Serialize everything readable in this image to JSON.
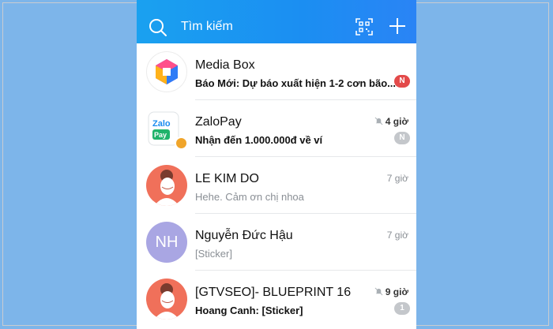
{
  "header": {
    "search_placeholder": "Tìm kiếm"
  },
  "colors": {
    "header_gradient_start": "#1aa1f0",
    "header_gradient_end": "#2a84f5",
    "badge_unread": "#e34a4a",
    "badge_muted": "#c4c7cb",
    "backdrop": "#7db5ea"
  },
  "icons": {
    "search": "search-icon",
    "qr": "qr-scan-icon",
    "add": "plus-icon",
    "muted": "muted-bell-icon"
  },
  "conversations": [
    {
      "name": "Media Box",
      "preview": "Báo Mới: Dự báo xuất hiện 1-2 cơn bão...",
      "time": "",
      "badge": "N",
      "muted": false,
      "unread": true
    },
    {
      "name": "ZaloPay",
      "preview": "Nhận đến 1.000.000đ về ví",
      "time": "4 giờ",
      "badge": "N",
      "muted": true,
      "unread": true
    },
    {
      "name": "LE KIM DO",
      "preview": "Hehe. Cảm ơn chị nhoa",
      "time": "7 giờ",
      "badge": "",
      "muted": false,
      "unread": false
    },
    {
      "name": "Nguyễn Đức Hậu",
      "preview": "[Sticker]",
      "time": "7 giờ",
      "badge": "",
      "muted": false,
      "unread": false,
      "initials": "NH"
    },
    {
      "name": "[GTVSEO]- BLUEPRINT 16",
      "preview": "Hoang Canh: [Sticker]",
      "time": "9 giờ",
      "badge": "1",
      "muted": true,
      "unread": true
    }
  ]
}
